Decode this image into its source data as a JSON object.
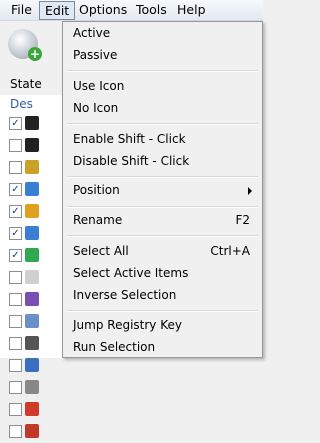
{
  "menubar": {
    "items": [
      "File",
      "Edit",
      "Options",
      "Tools",
      "Help"
    ]
  },
  "app": {
    "state_label": "State",
    "column_header": "Des",
    "rows": [
      {
        "checked": true,
        "icon_color": "#222222"
      },
      {
        "checked": false,
        "icon_color": "#222222"
      },
      {
        "checked": false,
        "icon_color": "#c9a227"
      },
      {
        "checked": true,
        "icon_color": "#3b7fd4"
      },
      {
        "checked": true,
        "icon_color": "#e0a020"
      },
      {
        "checked": true,
        "icon_color": "#3b7fd4"
      },
      {
        "checked": true,
        "icon_color": "#2fa84f"
      },
      {
        "checked": false,
        "icon_color": "#d0d0d0"
      },
      {
        "checked": false,
        "icon_color": "#7a4fb5"
      },
      {
        "checked": false,
        "icon_color": "#6a90c8"
      },
      {
        "checked": false,
        "icon_color": "#555555"
      },
      {
        "checked": false,
        "icon_color": "#3b6fc0"
      },
      {
        "checked": false,
        "icon_color": "#888888"
      },
      {
        "checked": false,
        "icon_color": "#d03a2a"
      },
      {
        "checked": false,
        "icon_color": "#c0392b"
      }
    ],
    "add_button_icon": "add-plus-icon"
  },
  "edit_menu": {
    "items": [
      {
        "label": "Active"
      },
      {
        "label": "Passive"
      },
      {
        "label": "Use Icon"
      },
      {
        "label": "No Icon"
      },
      {
        "label": "Enable Shift - Click"
      },
      {
        "label": "Disable Shift - Click"
      },
      {
        "label": "Position",
        "submenu": true
      },
      {
        "label": "Rename",
        "shortcut": "F2"
      },
      {
        "label": "Select All",
        "shortcut": "Ctrl+A"
      },
      {
        "label": "Select Active Items"
      },
      {
        "label": "Inverse Selection"
      },
      {
        "label": "Jump Registry Key"
      },
      {
        "label": "Run Selection"
      }
    ]
  }
}
